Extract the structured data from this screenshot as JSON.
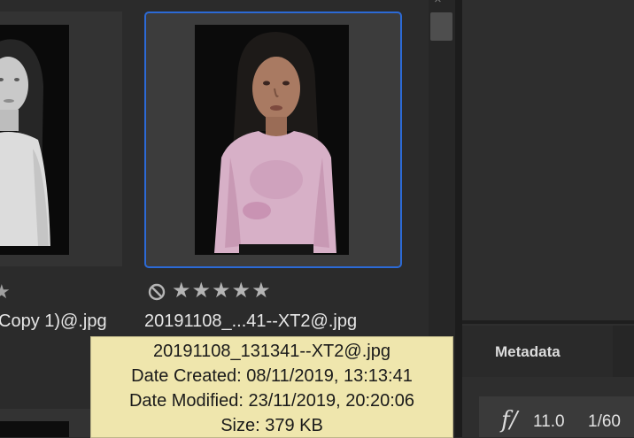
{
  "thumbnails": [
    {
      "filename": "Copy 1)@.jpg",
      "rating_stars": "★"
    },
    {
      "filename": "20191108_...41--XT2@.jpg",
      "rating_stars": "★★★★★",
      "reject_icon": "reject-circle-icon"
    }
  ],
  "tooltip": {
    "filename": "20191108_131341--XT2@.jpg",
    "date_created": "Date Created: 08/11/2019, 13:13:41",
    "date_modified": "Date Modified: 23/11/2019, 20:20:06",
    "size": "Size: 379 KB"
  },
  "panel": {
    "tab_label": "Metadata",
    "aperture_symbol": "f/",
    "aperture_value": "11.0",
    "shutter_value": "1/60"
  },
  "colors": {
    "selection": "#2c6ad6",
    "tooltip_bg": "#efe6ad"
  }
}
